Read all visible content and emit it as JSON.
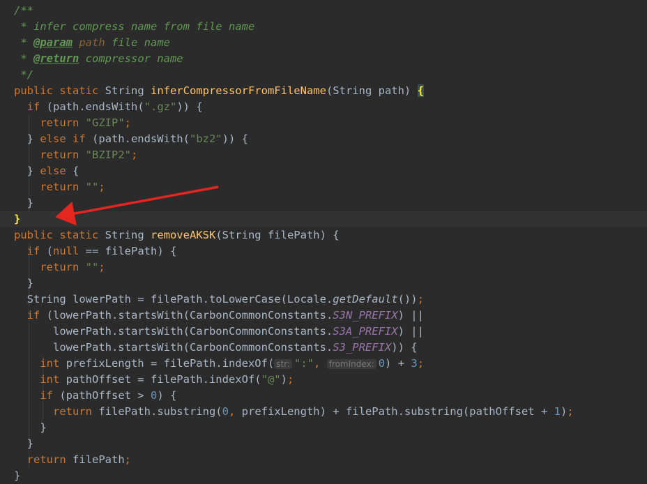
{
  "editor": {
    "colors": {
      "background": "#2b2b2b",
      "current_line": "#323232",
      "keyword": "#cc7832",
      "string": "#6a8759",
      "comment": "#629755",
      "function": "#ffc66d",
      "number": "#6897bb",
      "constant": "#9876aa",
      "annotation_arrow": "#e3261f"
    },
    "annotation": {
      "type": "arrow",
      "icon": "red-arrow-icon"
    },
    "lines": [
      [
        [
          "cm",
          "/**"
        ]
      ],
      [
        [
          "cm",
          " * infer compress name from file name"
        ]
      ],
      [
        [
          "cm",
          " * "
        ],
        [
          "tag",
          "@param"
        ],
        [
          "cm",
          " "
        ],
        [
          "param",
          "path"
        ],
        [
          "cm",
          " file name"
        ]
      ],
      [
        [
          "cm",
          " * "
        ],
        [
          "tag",
          "@return"
        ],
        [
          "cm",
          " compressor name"
        ]
      ],
      [
        [
          "cm",
          " */"
        ]
      ],
      [
        [
          "kw",
          "public static "
        ],
        [
          "plain",
          "String "
        ],
        [
          "fn",
          "inferCompressorFromFileName"
        ],
        [
          "plain",
          "(String path) "
        ],
        [
          "bracehl",
          "{"
        ]
      ],
      [
        [
          "plain",
          "  "
        ],
        [
          "kw",
          "if "
        ],
        [
          "plain",
          "(path.endsWith("
        ],
        [
          "str",
          "\".gz\""
        ],
        [
          "plain",
          ")) {"
        ]
      ],
      [
        [
          "plain",
          "    "
        ],
        [
          "kw",
          "return "
        ],
        [
          "str",
          "\"GZIP\""
        ],
        [
          "kw",
          ";"
        ]
      ],
      [
        [
          "plain",
          "  } "
        ],
        [
          "kw",
          "else if "
        ],
        [
          "plain",
          "(path.endsWith("
        ],
        [
          "str",
          "\"bz2\""
        ],
        [
          "plain",
          ")) {"
        ]
      ],
      [
        [
          "plain",
          "    "
        ],
        [
          "kw",
          "return "
        ],
        [
          "str",
          "\"BZIP2\""
        ],
        [
          "kw",
          ";"
        ]
      ],
      [
        [
          "plain",
          "  } "
        ],
        [
          "kw",
          "else "
        ],
        [
          "plain",
          "{"
        ]
      ],
      [
        [
          "plain",
          "    "
        ],
        [
          "kw",
          "return "
        ],
        [
          "str",
          "\"\""
        ],
        [
          "kw",
          ";"
        ]
      ],
      [
        [
          "plain",
          "  }"
        ]
      ],
      [
        [
          "braceyellow",
          "}"
        ]
      ],
      [
        [
          "kw",
          "public static "
        ],
        [
          "plain",
          "String "
        ],
        [
          "fn",
          "removeAKSK"
        ],
        [
          "plain",
          "(String filePath) {"
        ]
      ],
      [
        [
          "plain",
          "  "
        ],
        [
          "kw",
          "if "
        ],
        [
          "plain",
          "("
        ],
        [
          "kw",
          "null "
        ],
        [
          "plain",
          "== filePath) {"
        ]
      ],
      [
        [
          "plain",
          "    "
        ],
        [
          "kw",
          "return "
        ],
        [
          "str",
          "\"\""
        ],
        [
          "kw",
          ";"
        ]
      ],
      [
        [
          "plain",
          "  }"
        ]
      ],
      [
        [
          "plain",
          "  String lowerPath = filePath.toLowerCase(Locale."
        ],
        [
          "static",
          "getDefault"
        ],
        [
          "plain",
          "())"
        ],
        [
          "kw",
          ";"
        ]
      ],
      [
        [
          "plain",
          "  "
        ],
        [
          "kw",
          "if "
        ],
        [
          "plain",
          "(lowerPath.startsWith(CarbonCommonConstants."
        ],
        [
          "const",
          "S3N_PREFIX"
        ],
        [
          "plain",
          ") ||"
        ]
      ],
      [
        [
          "plain",
          "      lowerPath.startsWith(CarbonCommonConstants."
        ],
        [
          "const",
          "S3A_PREFIX"
        ],
        [
          "plain",
          ") ||"
        ]
      ],
      [
        [
          "plain",
          "      lowerPath.startsWith(CarbonCommonConstants."
        ],
        [
          "const",
          "S3_PREFIX"
        ],
        [
          "plain",
          ")) {"
        ]
      ],
      [
        [
          "plain",
          "    "
        ],
        [
          "kw",
          "int "
        ],
        [
          "plain",
          "prefixLength = filePath.indexOf("
        ],
        [
          "hint",
          "str:"
        ],
        [
          "str",
          "\":\""
        ],
        [
          "kw",
          ", "
        ],
        [
          "hint",
          "fromIndex:"
        ],
        [
          "num",
          "0"
        ],
        [
          "plain",
          ") + "
        ],
        [
          "num",
          "3"
        ],
        [
          "kw",
          ";"
        ]
      ],
      [
        [
          "plain",
          "    "
        ],
        [
          "kw",
          "int "
        ],
        [
          "plain",
          "pathOffset = filePath.indexOf("
        ],
        [
          "str",
          "\"@\""
        ],
        [
          "plain",
          ")"
        ],
        [
          "kw",
          ";"
        ]
      ],
      [
        [
          "plain",
          "    "
        ],
        [
          "kw",
          "if "
        ],
        [
          "plain",
          "(pathOffset > "
        ],
        [
          "num",
          "0"
        ],
        [
          "plain",
          ") {"
        ]
      ],
      [
        [
          "plain",
          "      "
        ],
        [
          "kw",
          "return "
        ],
        [
          "plain",
          "filePath.substring("
        ],
        [
          "num",
          "0"
        ],
        [
          "kw",
          ", "
        ],
        [
          "plain",
          "prefixLength) + filePath.substring(pathOffset + "
        ],
        [
          "num",
          "1"
        ],
        [
          "plain",
          ")"
        ],
        [
          "kw",
          ";"
        ]
      ],
      [
        [
          "plain",
          "    }"
        ]
      ],
      [
        [
          "plain",
          "  }"
        ]
      ],
      [
        [
          "plain",
          "  "
        ],
        [
          "kw",
          "return "
        ],
        [
          "plain",
          "filePath"
        ],
        [
          "kw",
          ";"
        ]
      ],
      [
        [
          "plain",
          "}"
        ]
      ]
    ]
  }
}
